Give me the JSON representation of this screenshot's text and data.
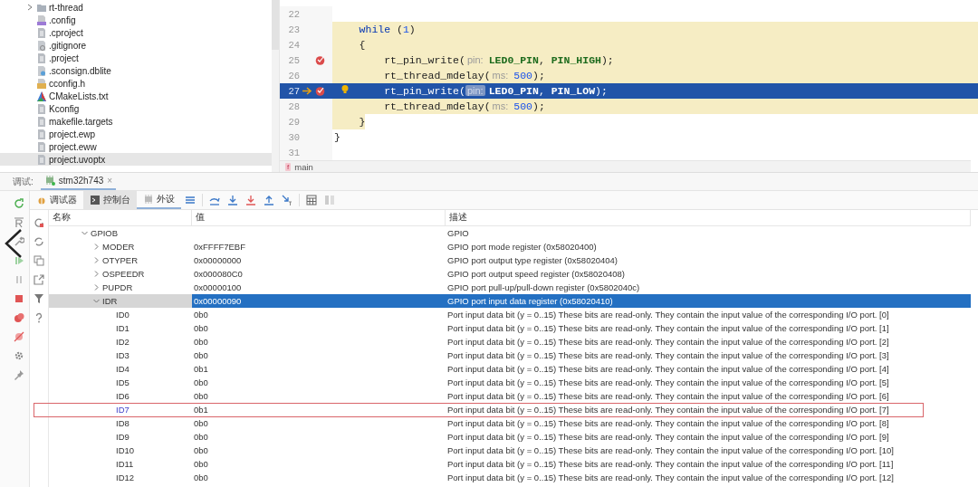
{
  "file_tree": {
    "items": [
      {
        "name": "rt-thread",
        "kind": "folder",
        "expanded": false,
        "selected": false
      },
      {
        "name": ".config",
        "kind": "config",
        "selected": false
      },
      {
        "name": ".cproject",
        "kind": "text",
        "selected": false
      },
      {
        "name": ".gitignore",
        "kind": "ignore",
        "selected": false
      },
      {
        "name": ".project",
        "kind": "text",
        "selected": false
      },
      {
        "name": ".sconsign.dblite",
        "kind": "unknown",
        "selected": false
      },
      {
        "name": "cconfig.h",
        "kind": "header",
        "selected": false
      },
      {
        "name": "CMakeLists.txt",
        "kind": "cmake",
        "selected": false
      },
      {
        "name": "Kconfig",
        "kind": "text",
        "selected": false
      },
      {
        "name": "makefile.targets",
        "kind": "text",
        "selected": false
      },
      {
        "name": "project.ewp",
        "kind": "text",
        "selected": false
      },
      {
        "name": "project.eww",
        "kind": "text",
        "selected": false
      },
      {
        "name": "project.uvoptx",
        "kind": "text",
        "selected": true
      }
    ]
  },
  "editor": {
    "lines": [
      {
        "number": "22",
        "kind": "plain"
      },
      {
        "number": "23",
        "kind": "highlighted",
        "tokens": [
          {
            "kind": "keyword",
            "text": "    while"
          },
          {
            "kind": "plain",
            "text": " ("
          },
          {
            "kind": "number",
            "text": "1"
          },
          {
            "kind": "plain",
            "text": ")"
          }
        ]
      },
      {
        "number": "24",
        "kind": "highlighted",
        "tokens": [
          {
            "kind": "plain",
            "text": "    {"
          }
        ]
      },
      {
        "number": "25",
        "kind": "highlighted",
        "breakpoint": true,
        "tokens": [
          {
            "kind": "plain",
            "text": "        rt_pin_write("
          },
          {
            "kind": "hint",
            "text": "pin:"
          },
          {
            "kind": "constant",
            "text": "LED0_PIN"
          },
          {
            "kind": "plain",
            "text": ", "
          },
          {
            "kind": "constant",
            "text": "PIN_HIGH"
          },
          {
            "kind": "plain",
            "text": ");"
          }
        ]
      },
      {
        "number": "26",
        "kind": "highlighted",
        "tokens": [
          {
            "kind": "plain",
            "text": "        rt_thread_mdelay("
          },
          {
            "kind": "hint",
            "text": "ms:"
          },
          {
            "kind": "number",
            "text": "500"
          },
          {
            "kind": "plain",
            "text": ");"
          }
        ]
      },
      {
        "number": "27",
        "kind": "execution",
        "breakpoint": true,
        "current": true,
        "bulb": true,
        "tokens": [
          {
            "kind": "plain",
            "text": "        rt_pin_write("
          },
          {
            "kind": "hint",
            "text": "pin:"
          },
          {
            "kind": "constant",
            "text": "LED0_PIN"
          },
          {
            "kind": "plain",
            "text": ", "
          },
          {
            "kind": "constant",
            "text": "PIN_LOW"
          },
          {
            "kind": "plain",
            "text": ");"
          }
        ]
      },
      {
        "number": "28",
        "kind": "highlighted",
        "tokens": [
          {
            "kind": "plain",
            "text": "        rt_thread_mdelay("
          },
          {
            "kind": "hint",
            "text": "ms:"
          },
          {
            "kind": "number",
            "text": "500"
          },
          {
            "kind": "plain",
            "text": ");"
          }
        ]
      },
      {
        "number": "29",
        "kind": "partial",
        "tokens": [
          {
            "kind": "plain",
            "text": "    }"
          }
        ]
      },
      {
        "number": "30",
        "kind": "plain",
        "tokens": [
          {
            "kind": "plain",
            "text": "}"
          }
        ]
      },
      {
        "number": "31",
        "kind": "plain"
      }
    ],
    "breadcrumb": {
      "badge": "f",
      "label": "main"
    }
  },
  "debug_bar": {
    "label": "调试:",
    "session_tab": {
      "label": "stm32h743",
      "close": "×"
    }
  },
  "toolbar": {
    "tabs": [
      {
        "label": "调试器",
        "selected": false,
        "highlighted": false
      },
      {
        "label": "控制台",
        "selected": false,
        "highlighted": true
      },
      {
        "label": "外设",
        "selected": true,
        "highlighted": false
      }
    ]
  },
  "table": {
    "columns": [
      "名称",
      "值",
      "描述"
    ],
    "rows": [
      {
        "name": "GPIOB",
        "description": "GPIO",
        "expanded": true,
        "selected": false,
        "children": [
          {
            "name": "MODER",
            "value": "0xFFFF7EBF",
            "description": "GPIO port mode register (0x58020400)",
            "expanded": false,
            "selected": false
          },
          {
            "name": "OTYPER",
            "value": "0x00000000",
            "description": "GPIO port output type register (0x58020404)",
            "expanded": false,
            "selected": false
          },
          {
            "name": "OSPEEDR",
            "value": "0x000080C0",
            "description": "GPIO port output speed register (0x58020408)",
            "expanded": false,
            "selected": false
          },
          {
            "name": "PUPDR",
            "value": "0x00000100",
            "description": "GPIO port pull-up/pull-down register (0x5802040c)",
            "expanded": false,
            "selected": false
          },
          {
            "name": "IDR",
            "value": "0x00000090",
            "description": "GPIO port input data register (0x58020410)",
            "expanded": true,
            "selected": true,
            "children": [
              {
                "name": "ID0",
                "value": "0b0",
                "description": "Port input data bit (y = 0..15) These bits are read-only. They contain the input value of the corresponding I/O port. [0]",
                "selected": false,
                "marked": false
              },
              {
                "name": "ID1",
                "value": "0b0",
                "description": "Port input data bit (y = 0..15) These bits are read-only. They contain the input value of the corresponding I/O port. [1]",
                "selected": false,
                "marked": false
              },
              {
                "name": "ID2",
                "value": "0b0",
                "description": "Port input data bit (y = 0..15) These bits are read-only. They contain the input value of the corresponding I/O port. [2]",
                "selected": false,
                "marked": false
              },
              {
                "name": "ID3",
                "value": "0b0",
                "description": "Port input data bit (y = 0..15) These bits are read-only. They contain the input value of the corresponding I/O port. [3]",
                "selected": false,
                "marked": false
              },
              {
                "name": "ID4",
                "value": "0b1",
                "description": "Port input data bit (y = 0..15) These bits are read-only. They contain the input value of the corresponding I/O port. [4]",
                "selected": false,
                "marked": false
              },
              {
                "name": "ID5",
                "value": "0b0",
                "description": "Port input data bit (y = 0..15) These bits are read-only. They contain the input value of the corresponding I/O port. [5]",
                "selected": false,
                "marked": false
              },
              {
                "name": "ID6",
                "value": "0b0",
                "description": "Port input data bit (y = 0..15) These bits are read-only. They contain the input value of the corresponding I/O port. [6]",
                "selected": false,
                "marked": false
              },
              {
                "name": "ID7",
                "value": "0b1",
                "description": "Port input data bit (y = 0..15) These bits are read-only. They contain the input value of the corresponding I/O port. [7]",
                "selected": false,
                "marked": true
              },
              {
                "name": "ID8",
                "value": "0b0",
                "description": "Port input data bit (y = 0..15) These bits are read-only. They contain the input value of the corresponding I/O port. [8]",
                "selected": false,
                "marked": false
              },
              {
                "name": "ID9",
                "value": "0b0",
                "description": "Port input data bit (y = 0..15) These bits are read-only. They contain the input value of the corresponding I/O port. [9]",
                "selected": false,
                "marked": false
              },
              {
                "name": "ID10",
                "value": "0b0",
                "description": "Port input data bit (y = 0..15) These bits are read-only. They contain the input value of the corresponding I/O port. [10]",
                "selected": false,
                "marked": false
              },
              {
                "name": "ID11",
                "value": "0b0",
                "description": "Port input data bit (y = 0..15) These bits are read-only. They contain the input value of the corresponding I/O port. [11]",
                "selected": false,
                "marked": false
              },
              {
                "name": "ID12",
                "value": "0b0",
                "description": "Port input data bit (y = 0..15) These bits are read-only. They contain the input value of the corresponding I/O port. [12]",
                "selected": false,
                "marked": false
              }
            ]
          }
        ]
      }
    ]
  }
}
